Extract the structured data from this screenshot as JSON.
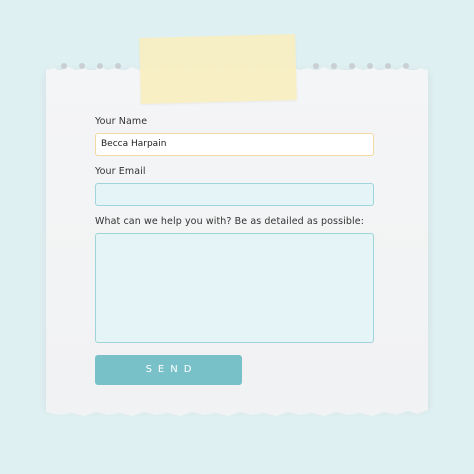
{
  "form": {
    "name_label": "Your Name",
    "name_value": "Becca Harpain",
    "email_label": "Your Email",
    "email_value": "",
    "message_label": "What can we help you with? Be as detailed as possible:",
    "message_value": "",
    "send_label": "SEND"
  },
  "colors": {
    "background": "#dff0f2",
    "paper": "#f2f3f4",
    "field_fill": "#e4f4f7",
    "field_border": "#9fd4d9",
    "button": "#78c1c9",
    "tape": "#f9eebe"
  }
}
